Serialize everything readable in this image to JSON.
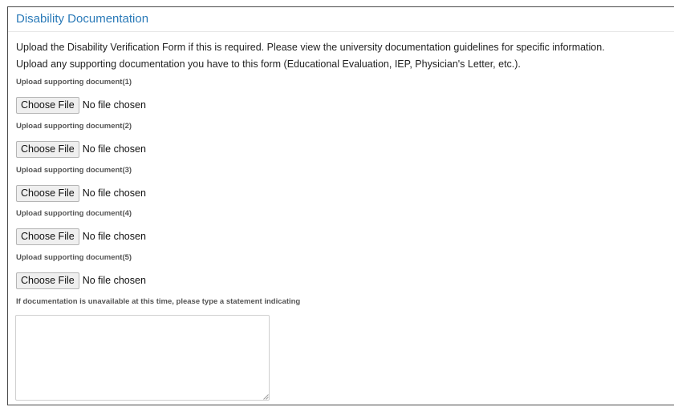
{
  "panel": {
    "title": "Disability Documentation",
    "intro": [
      "Upload the Disability Verification Form if this is required. Please view the university documentation guidelines for specific information.",
      "Upload any supporting documentation you have to this form (Educational Evaluation, IEP, Physician's Letter, etc.)."
    ],
    "uploads": [
      {
        "label": "Upload supporting document(1)",
        "button": "Choose File",
        "status": "No file chosen"
      },
      {
        "label": "Upload supporting document(2)",
        "button": "Choose File",
        "status": "No file chosen"
      },
      {
        "label": "Upload supporting document(3)",
        "button": "Choose File",
        "status": "No file chosen"
      },
      {
        "label": "Upload supporting document(4)",
        "button": "Choose File",
        "status": "No file chosen"
      },
      {
        "label": "Upload supporting document(5)",
        "button": "Choose File",
        "status": "No file chosen"
      }
    ],
    "statement_label": "If documentation is unavailable at this time, please type a statement indicating",
    "statement_value": ""
  },
  "colors": {
    "title": "#2a7ab8",
    "border": "#4a4a4a"
  }
}
